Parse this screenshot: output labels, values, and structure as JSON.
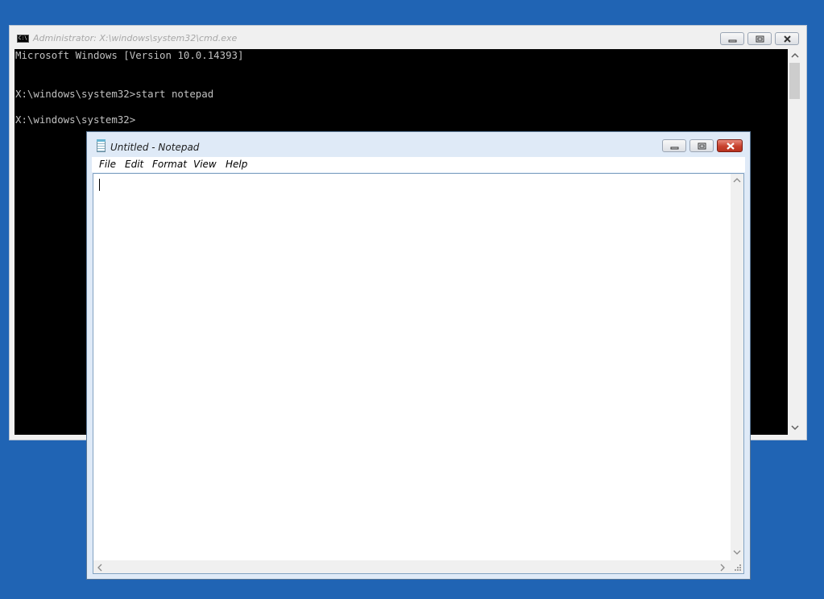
{
  "cmd": {
    "title": "Administrator: X:\\windows\\system32\\cmd.exe",
    "icon_text": "C:\\",
    "lines": [
      "Microsoft Windows [Version 10.0.14393]",
      "X:\\windows\\system32>start notepad",
      "X:\\windows\\system32>"
    ]
  },
  "notepad": {
    "title": "Untitled - Notepad",
    "menu": [
      "File",
      "Edit",
      "Format",
      "View",
      "Help"
    ],
    "text": ""
  },
  "colors": {
    "desktop": "#2064b4",
    "console_bg": "#000000",
    "console_fg": "#c0c0c0",
    "close_button": "#c7412e"
  },
  "icons": {
    "cmd_app": "console-icon",
    "notepad_app": "notepad-icon",
    "minimize": "minimize-icon",
    "maximize": "maximize-icon",
    "close": "close-icon"
  }
}
